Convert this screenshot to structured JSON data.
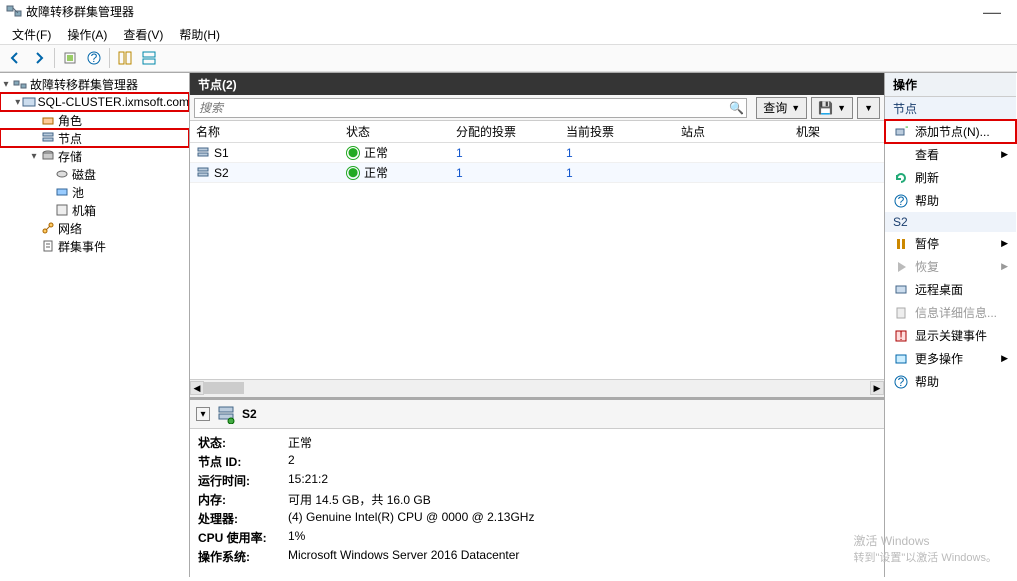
{
  "window": {
    "title": "故障转移群集管理器"
  },
  "menu": {
    "file": "文件(F)",
    "action": "操作(A)",
    "view": "查看(V)",
    "help": "帮助(H)"
  },
  "tree": {
    "root": "故障转移群集管理器",
    "cluster": "SQL-CLUSTER.ixmsoft.com",
    "roles": "角色",
    "nodes": "节点",
    "storage": "存储",
    "disks": "磁盘",
    "pools": "池",
    "enclosures": "机箱",
    "networks": "网络",
    "events": "群集事件"
  },
  "center": {
    "title": "节点(2)",
    "search_placeholder": "搜索",
    "query_label": "查询",
    "columns": {
      "name": "名称",
      "state": "状态",
      "vote1": "分配的投票",
      "vote2": "当前投票",
      "site": "站点",
      "rack": "机架"
    },
    "rows": [
      {
        "name": "S1",
        "state": "正常",
        "vote1": "1",
        "vote2": "1",
        "site": "",
        "rack": ""
      },
      {
        "name": "S2",
        "state": "正常",
        "vote1": "1",
        "vote2": "1",
        "site": "",
        "rack": ""
      }
    ]
  },
  "detail": {
    "node": "S2",
    "fields": {
      "state_k": "状态:",
      "state_v": "正常",
      "id_k": "节点 ID:",
      "id_v": "2",
      "uptime_k": "运行时间:",
      "uptime_v": "15:21:2",
      "mem_k": "内存:",
      "mem_v": "可用 14.5 GB，共 16.0 GB",
      "cpu_k": "处理器:",
      "cpu_v": "(4) Genuine Intel(R) CPU           @ 0000 @ 2.13GHz",
      "cpuuse_k": "CPU 使用率:",
      "cpuuse_v": "1%",
      "os_k": "操作系统:",
      "os_v": "Microsoft Windows Server 2016 Datacenter"
    }
  },
  "actions": {
    "title": "操作",
    "group1": "节点",
    "add_node": "添加节点(N)...",
    "view": "查看",
    "refresh": "刷新",
    "help": "帮助",
    "group2": "S2",
    "pause": "暂停",
    "resume": "恢复",
    "remote": "远程桌面",
    "info": "信息详细信息...",
    "critical": "显示关键事件",
    "more": "更多操作",
    "help2": "帮助"
  },
  "watermark": {
    "l1": "激活 Windows",
    "l2": "转到\"设置\"以激活 Windows。"
  }
}
